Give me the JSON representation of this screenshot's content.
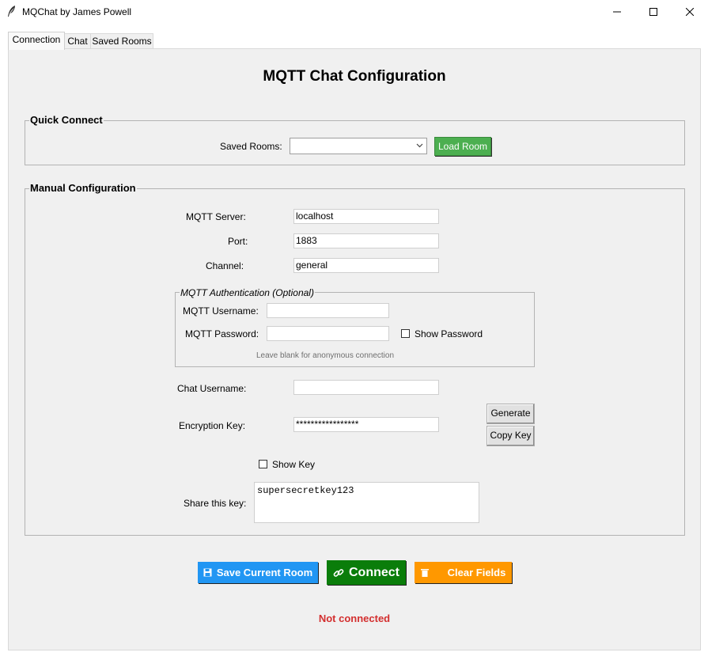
{
  "window": {
    "title": "MQChat by James Powell"
  },
  "tabs": [
    {
      "label": "Connection"
    },
    {
      "label": "Chat"
    },
    {
      "label": "Saved Rooms"
    }
  ],
  "header": {
    "title": "MQTT Chat Configuration"
  },
  "quick_connect": {
    "legend": "Quick Connect",
    "saved_rooms_label": "Saved Rooms:",
    "saved_rooms_value": "",
    "load_button": "Load Room"
  },
  "manual": {
    "legend": "Manual Configuration",
    "server_label": "MQTT Server:",
    "server_value": "localhost",
    "port_label": "Port:",
    "port_value": "1883",
    "channel_label": "Channel:",
    "channel_value": "general",
    "auth": {
      "legend": "MQTT Authentication (Optional)",
      "username_label": "MQTT Username:",
      "username_value": "",
      "password_label": "MQTT Password:",
      "password_value": "",
      "show_password_label": "Show Password",
      "hint": "Leave blank for anonymous connection"
    },
    "chat_username_label": "Chat Username:",
    "chat_username_value": "",
    "encryption_label": "Encryption Key:",
    "encryption_value": "*****************",
    "generate_button": "Generate",
    "copy_key_button": "Copy Key",
    "show_key_label": "Show Key",
    "share_label": "Share this key:",
    "share_value": "supersecretkey123"
  },
  "actions": {
    "save_room": "Save Current Room",
    "connect": "Connect",
    "clear_fields": "Clear Fields"
  },
  "status": {
    "text": "Not connected"
  },
  "colors": {
    "load_green": "#4caf50",
    "save_blue": "#2196f3",
    "connect_green": "#0a7d0a",
    "clear_orange": "#ff9800",
    "status_red": "#d32f2f"
  }
}
